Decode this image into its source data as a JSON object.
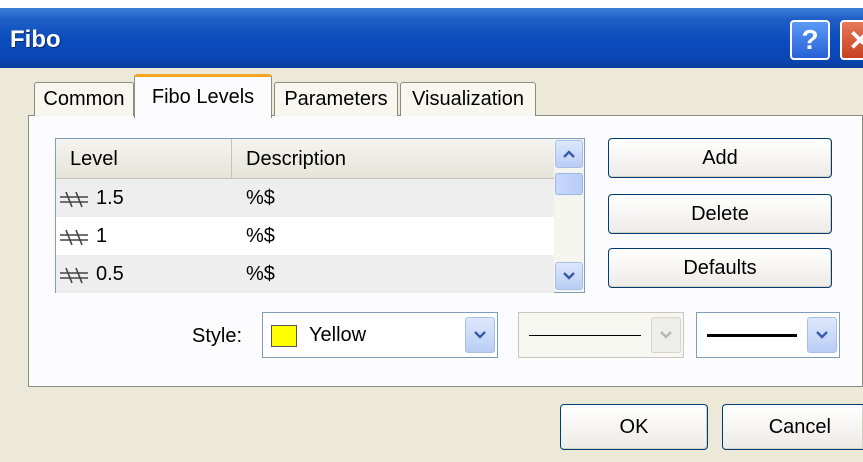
{
  "window": {
    "title": "Fibo",
    "help_glyph": "?",
    "close_glyph": "✕"
  },
  "tabs": [
    {
      "label": "Common",
      "active": false
    },
    {
      "label": "Fibo Levels",
      "active": true
    },
    {
      "label": "Parameters",
      "active": false
    },
    {
      "label": "Visualization",
      "active": false
    }
  ],
  "levels_table": {
    "headers": {
      "level": "Level",
      "description": "Description"
    },
    "rows": [
      {
        "level": "1.5",
        "description": "%$"
      },
      {
        "level": "1",
        "description": "%$"
      },
      {
        "level": "0.5",
        "description": "%$"
      }
    ]
  },
  "side_buttons": {
    "add": "Add",
    "delete": "Delete",
    "defaults": "Defaults"
  },
  "style": {
    "label": "Style:",
    "color_name": "Yellow",
    "color_hex": "#ffff00"
  },
  "footer": {
    "ok": "OK",
    "cancel": "Cancel"
  },
  "colors": {
    "titlebar": "#0a4bbd",
    "dialog_bg": "#ece9d8",
    "active_tab_accent": "#f5a623"
  }
}
